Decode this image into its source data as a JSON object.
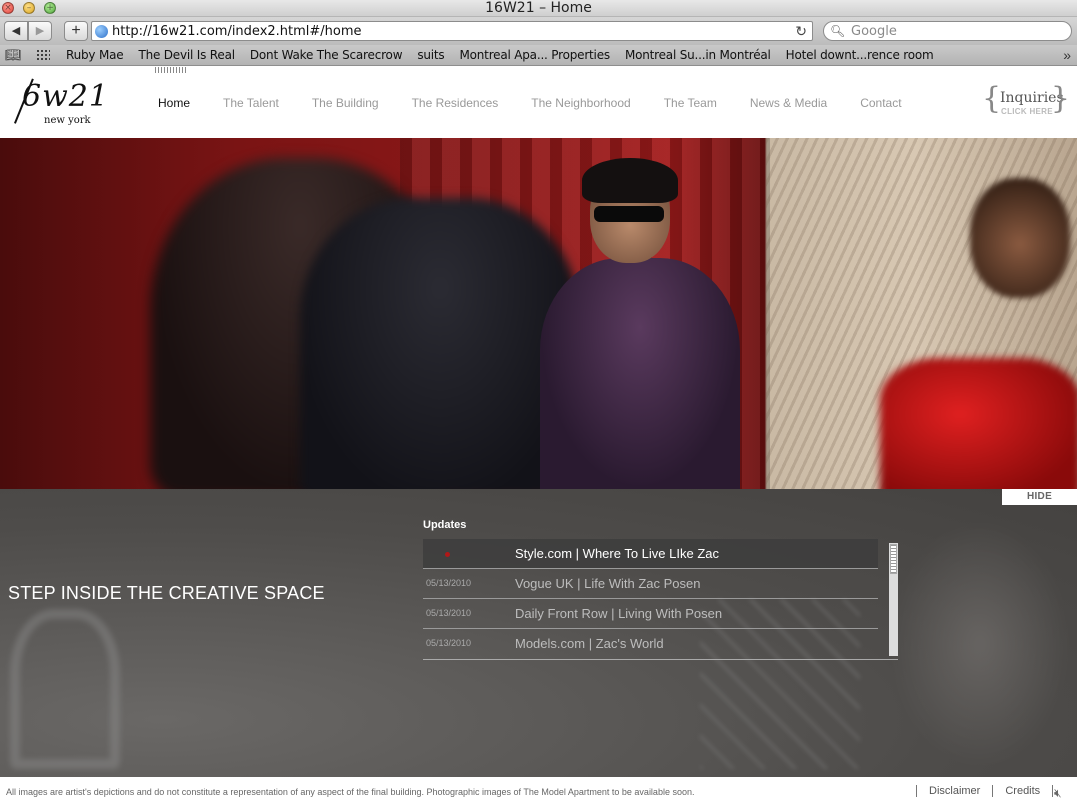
{
  "browser": {
    "window_title": "16W21 – Home",
    "url": "http://16w21.com/index2.html#/home",
    "search_placeholder": "Google",
    "bookmarks": [
      "Ruby Mae",
      "The Devil Is Real",
      "Dont Wake The Scarecrow",
      "suits",
      "Montreal Apa... Properties",
      "Montreal Su...in Montréal",
      "Hotel downt...rence room"
    ],
    "icons": {
      "back": "back-arrow-icon",
      "forward": "forward-arrow-icon",
      "add": "add-bookmark-icon",
      "reload": "reload-icon",
      "search": "search-icon",
      "bookmarks_book": "book-icon",
      "top_sites": "grid-icon",
      "overflow": "chevron-double-right-icon"
    }
  },
  "site": {
    "logo": {
      "main": "6w21",
      "sub": "new york"
    },
    "nav": [
      "Home",
      "The Talent",
      "The Building",
      "The Residences",
      "The Neighborhood",
      "The Team",
      "News & Media",
      "Contact"
    ],
    "active_nav": "Home",
    "inquiries": {
      "label": "Inquiries",
      "sub": "CLICK HERE"
    },
    "hide_label": "HIDE",
    "tagline": "STEP INSIDE THE CREATIVE SPACE",
    "updates": {
      "title": "Updates",
      "items": [
        {
          "date": "",
          "title": "Style.com | Where To Live LIke Zac",
          "featured": true
        },
        {
          "date": "05/13/2010",
          "title": "Vogue UK | Life With Zac Posen",
          "featured": false
        },
        {
          "date": "05/13/2010",
          "title": "Daily Front Row | Living With Posen",
          "featured": false
        },
        {
          "date": "05/13/2010",
          "title": "Models.com | Zac's World",
          "featured": false
        }
      ]
    },
    "footer": {
      "disclaimer_text": "All images are artist's depictions and do not constitute a representation of any aspect of the final building. Photographic images of The Model Apartment to be available soon.",
      "links": [
        "Disclaimer",
        "Credits"
      ],
      "sound_icon": "speaker-mute-icon"
    },
    "colors": {
      "accent_red": "#b01818",
      "panel_gray": "#4e4c4a"
    }
  }
}
